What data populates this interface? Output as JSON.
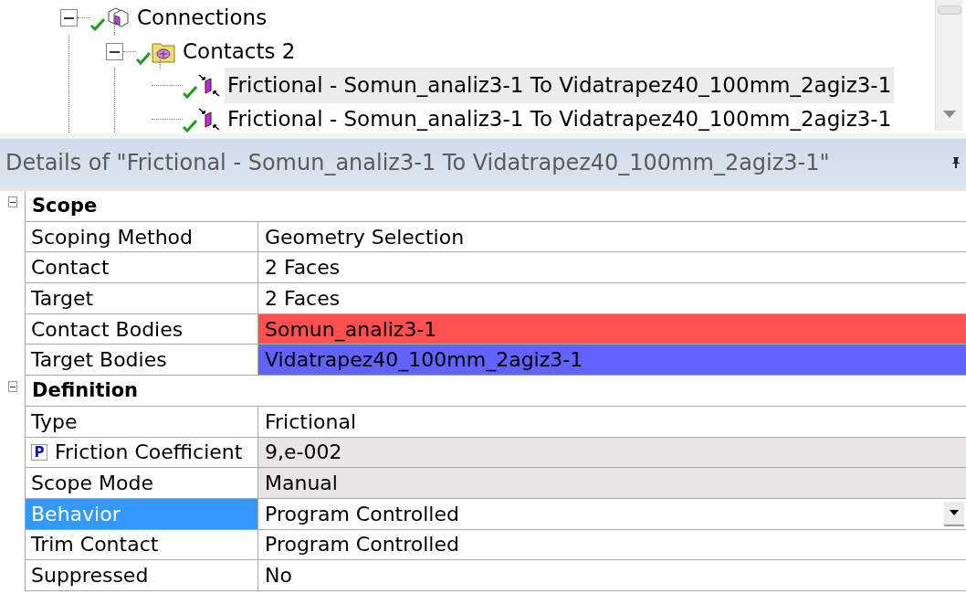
{
  "tree": [
    {
      "label": "Connections",
      "kind": "connections",
      "expanded": true,
      "selected": false,
      "children": [
        {
          "label": "Contacts 2",
          "kind": "folder",
          "expanded": true,
          "selected": false,
          "children": [
            {
              "label": "Frictional - Somun_analiz3-1 To Vidatrapez40_100mm_2agiz3-1",
              "kind": "contact",
              "selected": true
            },
            {
              "label": "Frictional - Somun_analiz3-1 To Vidatrapez40_100mm_2agiz3-1",
              "kind": "contact",
              "selected": false
            }
          ]
        }
      ]
    }
  ],
  "details": {
    "title": "Details of \"Frictional - Somun_analiz3-1 To Vidatrapez40_100mm_2agiz3-1\"",
    "sections": [
      {
        "label": "Scope",
        "expanded": true,
        "rows": [
          {
            "label": "Scoping Method",
            "value": "Geometry Selection",
            "selected": false,
            "readonly": false,
            "parameter": false,
            "kind": "text"
          },
          {
            "label": "Contact",
            "value": "2 Faces",
            "selected": false,
            "readonly": false,
            "parameter": false,
            "kind": "text"
          },
          {
            "label": "Target",
            "value": "2 Faces",
            "selected": false,
            "readonly": false,
            "parameter": false,
            "kind": "text"
          },
          {
            "label": "Contact Bodies",
            "value": "Somun_analiz3-1",
            "selected": false,
            "readonly": false,
            "parameter": false,
            "kind": "text",
            "color": "#ff5050"
          },
          {
            "label": "Target Bodies",
            "value": "Vidatrapez40_100mm_2agiz3-1",
            "selected": false,
            "readonly": false,
            "parameter": false,
            "kind": "text",
            "color": "#6262ff"
          }
        ]
      },
      {
        "label": "Definition",
        "expanded": true,
        "rows": [
          {
            "label": "Type",
            "value": "Frictional",
            "selected": false,
            "readonly": false,
            "parameter": false,
            "kind": "text"
          },
          {
            "label": "Friction Coefficient",
            "value": "9,e-002",
            "selected": false,
            "readonly": true,
            "parameter": true,
            "parameter_mark": "P",
            "kind": "text"
          },
          {
            "label": "Scope Mode",
            "value": "Manual",
            "selected": false,
            "readonly": true,
            "parameter": false,
            "kind": "text"
          },
          {
            "label": "Behavior",
            "value": "Program Controlled",
            "selected": true,
            "readonly": false,
            "parameter": false,
            "kind": "dropdown"
          },
          {
            "label": "Trim Contact",
            "value": "Program Controlled",
            "selected": false,
            "readonly": false,
            "parameter": false,
            "kind": "text"
          },
          {
            "label": "Suppressed",
            "value": "No",
            "selected": false,
            "readonly": false,
            "parameter": false,
            "kind": "text"
          }
        ]
      }
    ]
  }
}
